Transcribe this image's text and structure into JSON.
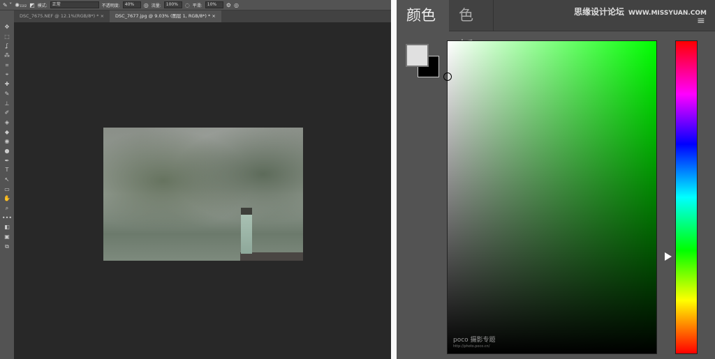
{
  "options_bar": {
    "brush_size": "1102",
    "mode_label": "模式:",
    "mode_value": "正常",
    "opacity_label": "不透明度:",
    "opacity_value": "40%",
    "flow_label": "流量:",
    "flow_value": "100%",
    "smoothing_label": "平滑:",
    "smoothing_value": "10%"
  },
  "doc_tabs": [
    {
      "label": "DSC_7675.NEF @ 12.1%(RGB/8*) *",
      "close": "×",
      "active": false
    },
    {
      "label": "DSC_7677.jpg @ 9.03% (图层 1, RGB/8*) *",
      "close": "×",
      "active": true
    }
  ],
  "tools": [
    "✥",
    "⬚",
    "ʆ",
    "⁂",
    "⌗",
    "⌖",
    "✚",
    "✎",
    "⊥",
    "✐",
    "◈",
    "◆",
    "◉",
    "●",
    "✒",
    "T",
    "↖",
    "▭",
    "✋",
    "⌕",
    "•••",
    "◧",
    "▣",
    "⧉"
  ],
  "panel": {
    "tabs": [
      "颜色",
      "色板"
    ],
    "watermark": "思缘设计论坛",
    "watermark_url": "WWW.MISSYUAN.COM",
    "menu_icon": "≡"
  },
  "colors": {
    "foreground": "#e0e0e0",
    "background": "#000000",
    "hue": "#00ff00"
  },
  "photo_watermark": {
    "brand": "poco 摄影专题",
    "url": "http://photo.poco.cn/"
  }
}
